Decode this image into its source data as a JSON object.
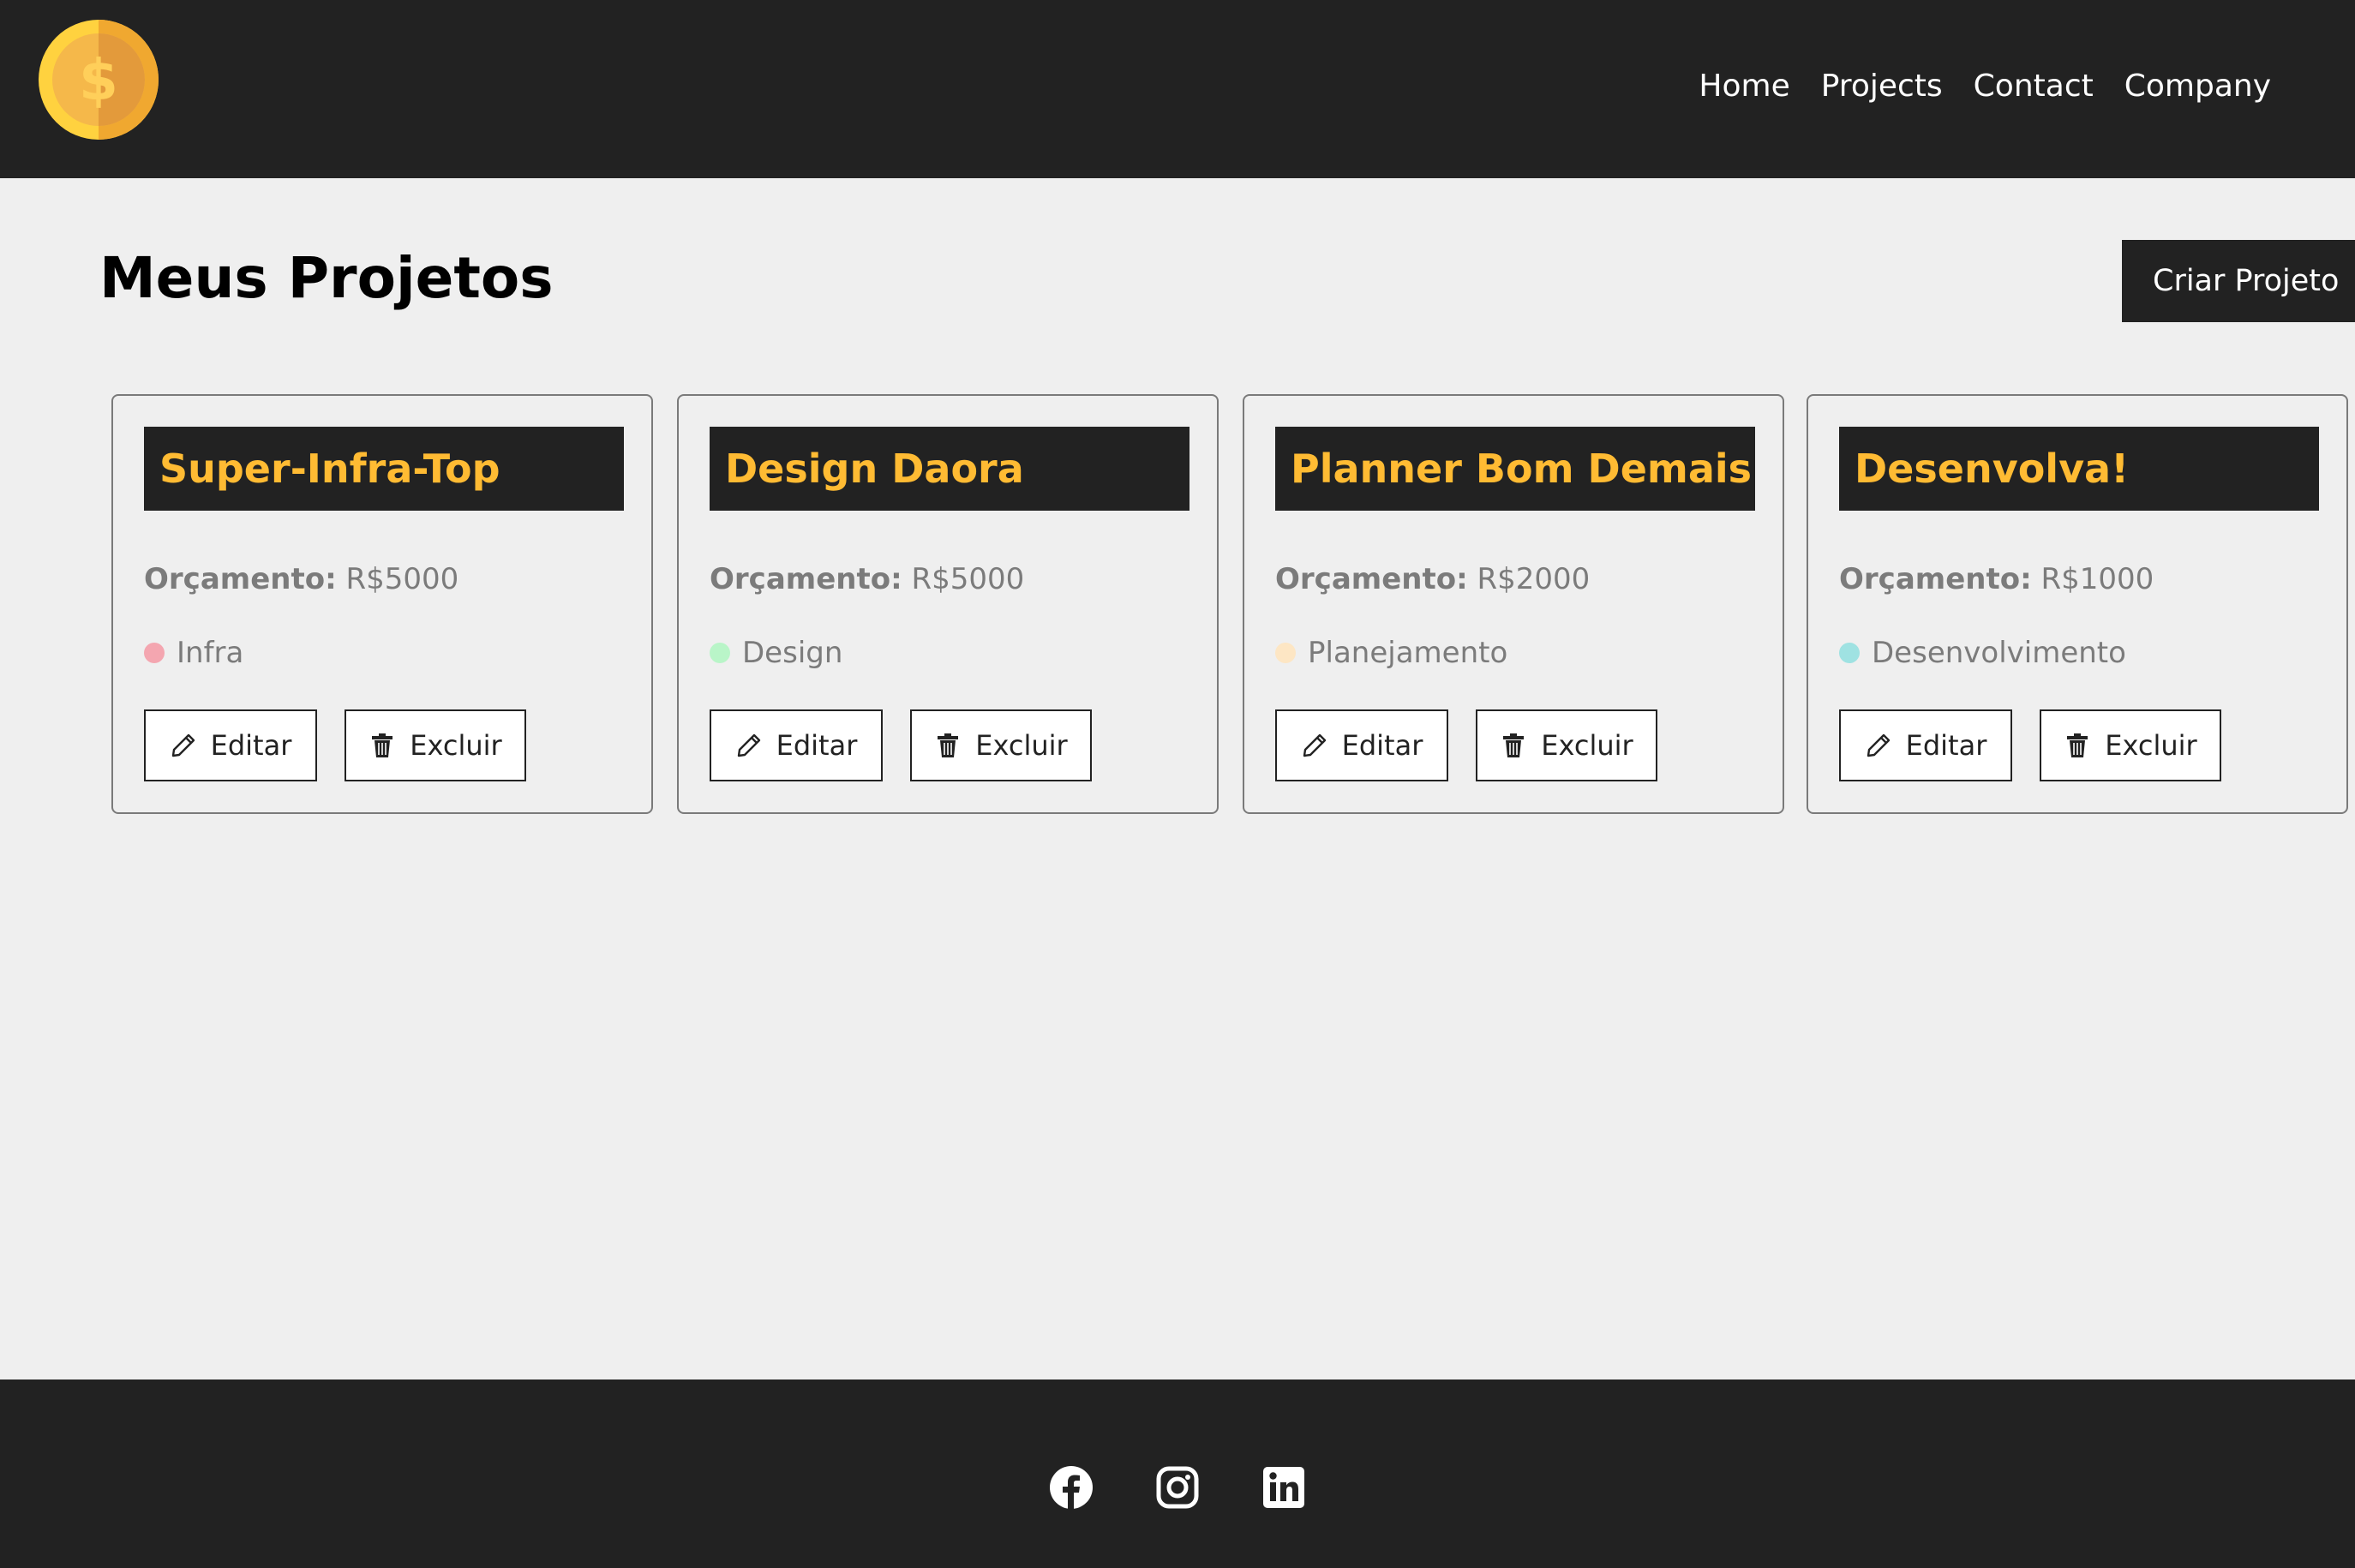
{
  "nav": {
    "logo_icon": "dollar-coin-icon",
    "links": [
      "Home",
      "Projects",
      "Contact",
      "Company"
    ]
  },
  "page": {
    "title": "Meus Projetos",
    "create_label": "Criar Projeto"
  },
  "projects": [
    {
      "name": "Super-Infra-Top",
      "budget_label": "Orçamento:",
      "budget_value": "R$5000",
      "category": "Infra",
      "category_color": "#f4a6b0",
      "edit_label": "Editar",
      "delete_label": "Excluir"
    },
    {
      "name": "Design Daora",
      "budget_label": "Orçamento:",
      "budget_value": "R$5000",
      "category": "Design",
      "category_color": "#b9f5c8",
      "edit_label": "Editar",
      "delete_label": "Excluir"
    },
    {
      "name": "Planner Bom Demais",
      "budget_label": "Orçamento:",
      "budget_value": "R$2000",
      "category": "Planejamento",
      "category_color": "#fde6c4",
      "edit_label": "Editar",
      "delete_label": "Excluir"
    },
    {
      "name": "Desenvolva!",
      "budget_label": "Orçamento:",
      "budget_value": "R$1000",
      "category": "Desenvolvimento",
      "category_color": "#9fe2e2",
      "edit_label": "Editar",
      "delete_label": "Excluir"
    }
  ],
  "footer": {
    "social_icons": [
      "facebook-icon",
      "instagram-icon",
      "linkedin-icon"
    ]
  },
  "colors": {
    "dark": "#222222",
    "accent": "#ffbb33",
    "background": "#efefef"
  }
}
